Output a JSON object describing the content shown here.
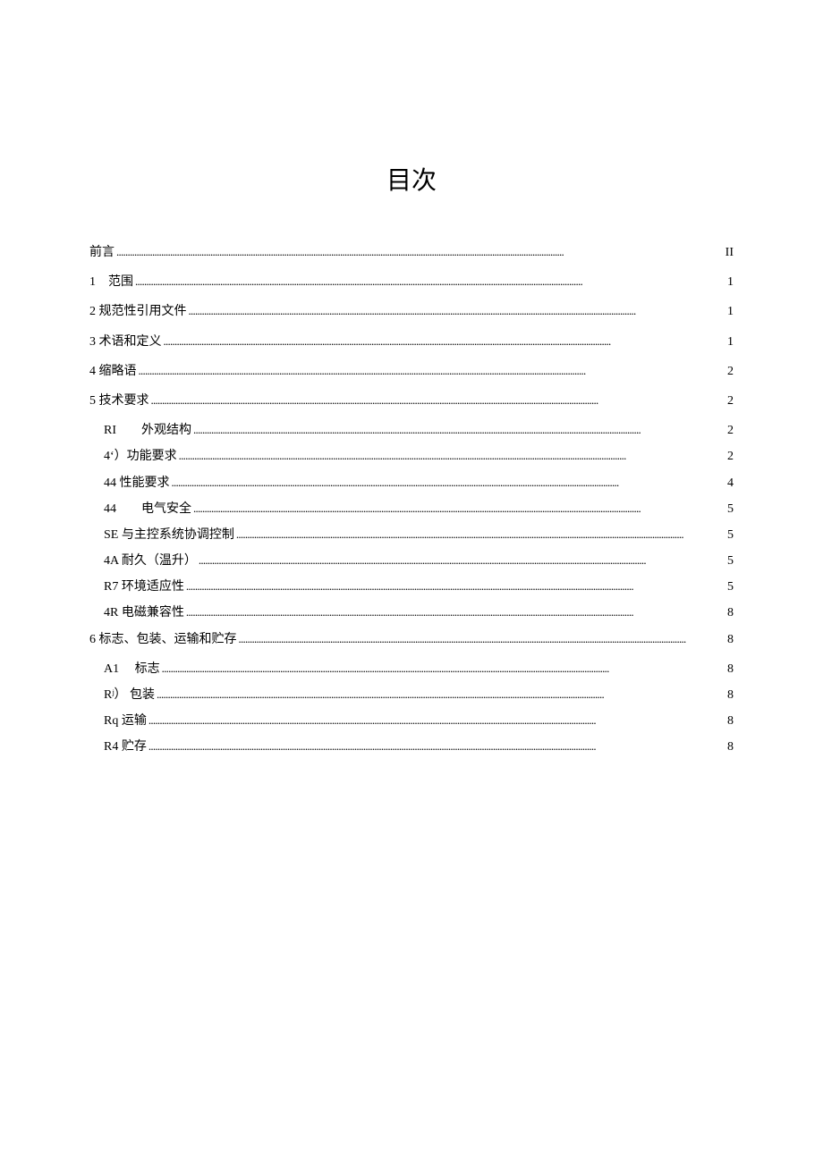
{
  "title": "目次",
  "toc": [
    {
      "level": 1,
      "label": "前言",
      "page": "II"
    },
    {
      "level": 1,
      "label": "1　范围",
      "page": "1"
    },
    {
      "level": 1,
      "label": "2 规范性引用文件",
      "page": "1"
    },
    {
      "level": 1,
      "label": "3 术语和定义",
      "page": "1"
    },
    {
      "level": 1,
      "label": "4 缩略语",
      "page": "2"
    },
    {
      "level": 1,
      "label": "5 技术要求",
      "page": "2"
    },
    {
      "level": 2,
      "label": "RI　　外观结构",
      "page": "2"
    },
    {
      "level": 2,
      "label": "4ʻ）功能要求",
      "page": "2"
    },
    {
      "level": 2,
      "label": "44 性能要求",
      "page": "4"
    },
    {
      "level": 2,
      "label": "44　　电气安全",
      "page": "5"
    },
    {
      "level": 2,
      "label": "SE 与主控系统协调控制",
      "page": "5"
    },
    {
      "level": 2,
      "label": "4A 耐久（温升）",
      "page": "5"
    },
    {
      "level": 2,
      "label": "R7 环境适应性",
      "page": "5"
    },
    {
      "level": 2,
      "label": "4R 电磁兼容性",
      "page": "8"
    },
    {
      "level": 1,
      "label": "6 标志、包装、运输和贮存",
      "page": "8"
    },
    {
      "level": 2,
      "label": "A1　 标志",
      "page": "8"
    },
    {
      "level": 2,
      "label": "Rʲ）  包装",
      "page": "8"
    },
    {
      "level": 2,
      "label": "Rq 运输",
      "page": "8"
    },
    {
      "level": 2,
      "label": "R4 贮存",
      "page": "8"
    }
  ]
}
